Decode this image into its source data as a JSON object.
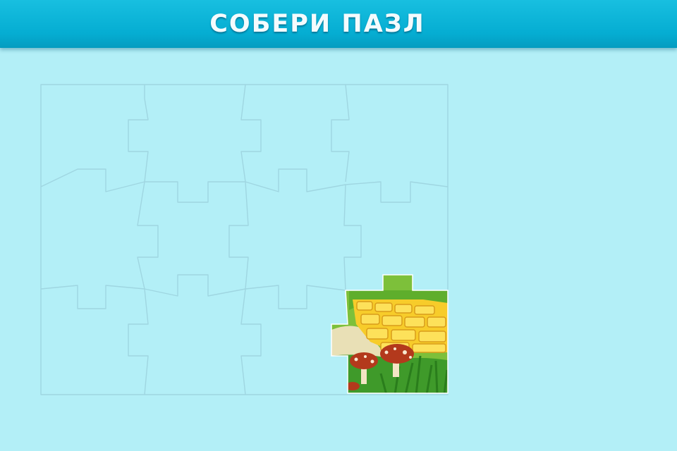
{
  "header": {
    "title": "СОБЕРИ ПАЗЛ"
  },
  "puzzle": {
    "rows": 3,
    "cols": 4,
    "placed_pieces": [
      {
        "row": 2,
        "col": 3,
        "picture": "yellow-brick-road-with-mushrooms"
      }
    ]
  },
  "colors": {
    "header": "#05add2",
    "background": "#b3eff7",
    "outline": "#9fd6e1"
  }
}
